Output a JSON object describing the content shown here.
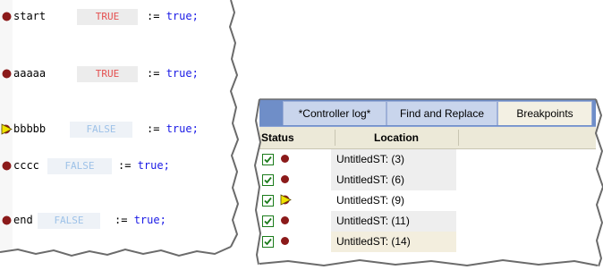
{
  "editor": {
    "lines": [
      {
        "var": "start",
        "monitor": "TRUE",
        "state": "true",
        "assign": ":= ",
        "keyword": "true;",
        "marker": "breakpoint"
      },
      {
        "var": "aaaaa",
        "monitor": "TRUE",
        "state": "true",
        "assign": ":= ",
        "keyword": "true;",
        "marker": "breakpoint"
      },
      {
        "var": "bbbbb",
        "monitor": "FALSE",
        "state": "false",
        "assign": ":= ",
        "keyword": "true;",
        "marker": "current"
      },
      {
        "var": "cccc",
        "monitor": "FALSE",
        "state": "false",
        "assign": ":= ",
        "keyword": "true;",
        "marker": "breakpoint"
      },
      {
        "var": "end",
        "monitor": "FALSE",
        "state": "false",
        "assign": ":= ",
        "keyword": "true;",
        "marker": "breakpoint"
      }
    ]
  },
  "panel": {
    "tabs": [
      {
        "label": "*Controller log*",
        "active": false
      },
      {
        "label": "Find and Replace",
        "active": false
      },
      {
        "label": "Breakpoints",
        "active": true
      }
    ],
    "columns": {
      "status": "Status",
      "location": "Location"
    },
    "rows": [
      {
        "checked": true,
        "marker": "breakpoint",
        "location": "UntitledST: (3)"
      },
      {
        "checked": true,
        "marker": "breakpoint",
        "location": "UntitledST: (6)"
      },
      {
        "checked": true,
        "marker": "current",
        "location": "UntitledST: (9)"
      },
      {
        "checked": true,
        "marker": "breakpoint",
        "location": "UntitledST: (11)"
      },
      {
        "checked": true,
        "marker": "breakpoint",
        "location": "UntitledST: (14)"
      }
    ]
  },
  "colors": {
    "breakpoint": "#8b1a1a",
    "current_line": "#f2e200",
    "true_value": "#e44f4f",
    "false_value": "#9ec2e8",
    "keyword": "#1a1ae6",
    "tab_strip": "#6f8ec8"
  }
}
